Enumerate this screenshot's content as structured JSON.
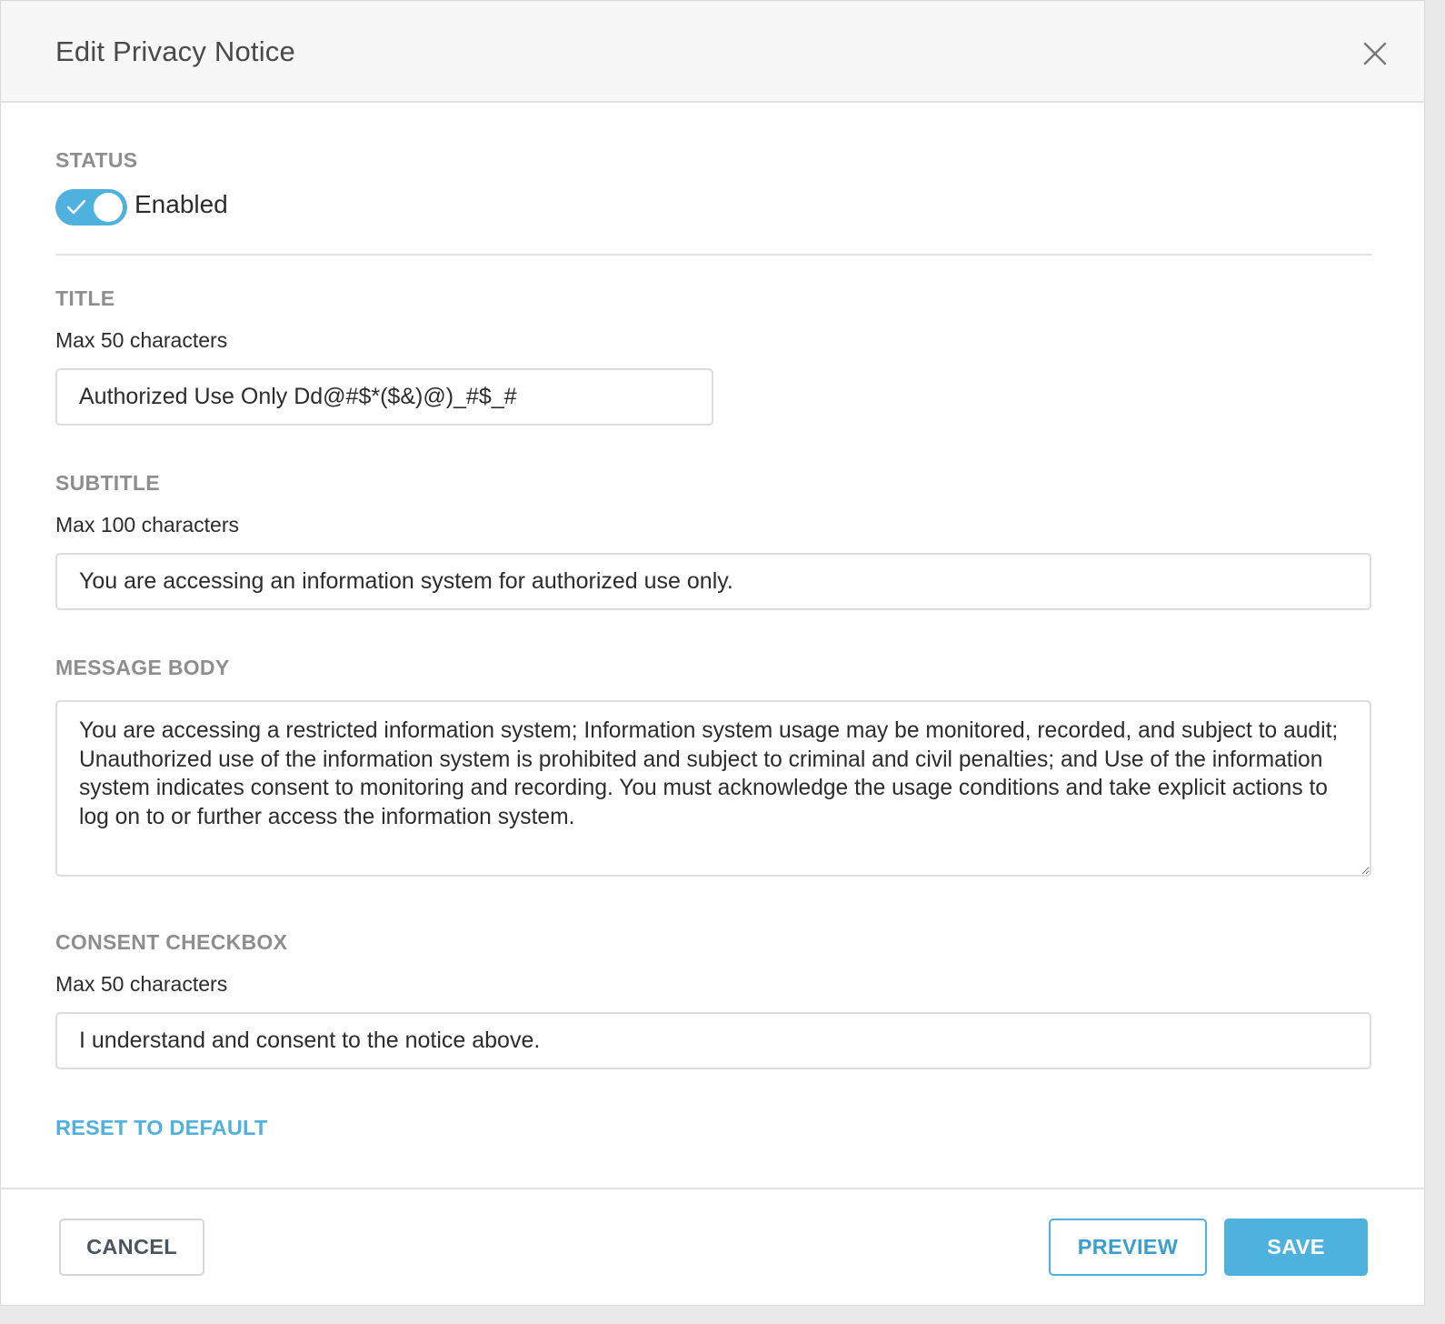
{
  "dialog": {
    "title": "Edit Privacy Notice"
  },
  "status": {
    "label": "STATUS",
    "toggle_state": "on",
    "toggle_text": "Enabled"
  },
  "title_field": {
    "label": "TITLE",
    "helper": "Max 50 characters",
    "value": "Authorized Use Only Dd@#$*($&)@)_#$_#"
  },
  "subtitle_field": {
    "label": "SUBTITLE",
    "helper": "Max 100 characters",
    "value": "You are accessing an information system for authorized use only."
  },
  "message_body": {
    "label": "MESSAGE BODY",
    "value": "You are accessing a restricted information system; Information system usage may be monitored, recorded, and subject to audit; Unauthorized use of the information system is prohibited and subject to criminal and civil penalties; and Use of the information system indicates consent to monitoring and recording. You must acknowledge the usage conditions and take explicit actions to log on to or further access the information system."
  },
  "consent_field": {
    "label": "CONSENT CHECKBOX",
    "helper": "Max 50 characters",
    "value": "I understand and consent to the notice above."
  },
  "reset_link": "RESET TO DEFAULT",
  "footer": {
    "cancel_label": "CANCEL",
    "preview_label": "PREVIEW",
    "save_label": "SAVE"
  },
  "colors": {
    "accent": "#4fb1de",
    "label_gray": "#8e8e8e",
    "text": "#2c2c2c"
  },
  "icons": {
    "close": "close-icon",
    "toggle_check": "checkmark-icon",
    "resize": "resize-handle-icon"
  }
}
